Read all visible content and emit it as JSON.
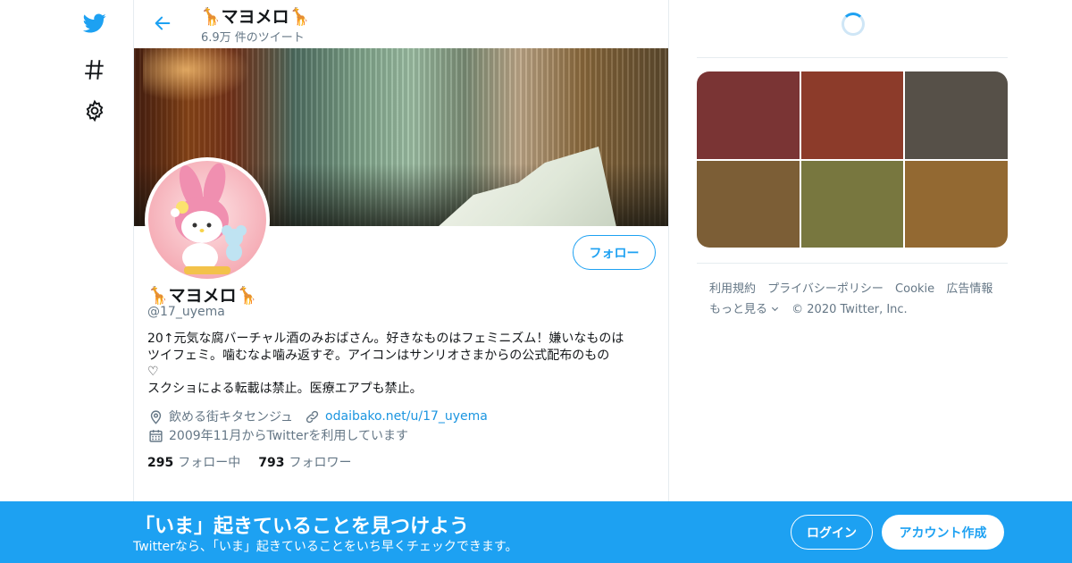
{
  "nav": {
    "icons": [
      "twitter-logo-icon",
      "hashtag-icon",
      "gear-icon"
    ],
    "accent_color": "#1da1f2"
  },
  "header": {
    "name": "🦒マヨメロ🦒",
    "tweet_count": "6.9万 件のツイート"
  },
  "profile": {
    "name": "🦒マヨメロ🦒",
    "handle": "@17_uyema",
    "follow_label": "フォロー",
    "bio_lines": [
      "20↑元気な腐バーチャル酒のみおばさん。好きなものはフェミニズム！嫌いなものは",
      "ツイフェミ。噛むなよ噛み返すぞ。アイコンはサンリオさまからの公式配布のもの",
      "♡",
      "スクショによる転載は禁止。医療エアプも禁止。"
    ],
    "location": "飲める街キタセンジュ",
    "url": "odaibako.net/u/17_uyema",
    "joined": "2009年11月からTwitterを利用しています",
    "following_count": "295",
    "following_label": "フォロー中",
    "followers_count": "793",
    "followers_label": "フォロワー"
  },
  "right": {
    "media_colors": [
      "#7a3434",
      "#8c3b2a",
      "#565048",
      "#7c5e36",
      "#78773f",
      "#936932"
    ],
    "footer": {
      "terms": "利用規約",
      "privacy": "プライバシーポリシー",
      "cookie": "Cookie",
      "ads": "広告情報",
      "more": "もっと見る",
      "copyright": "© 2020 Twitter, Inc."
    }
  },
  "bottom_bar": {
    "title": "「いま」起きていることを見つけよう",
    "subtitle": "Twitterなら、「いま」起きていることをいち早くチェックできます。",
    "login_label": "ログイン",
    "signup_label": "アカウント作成"
  }
}
